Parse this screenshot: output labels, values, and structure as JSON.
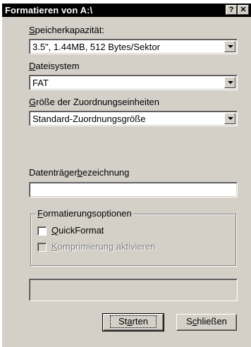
{
  "window": {
    "title": "Formatieren von A:\\",
    "help_button": "?",
    "close_button": "✕"
  },
  "capacity": {
    "label_accel": "S",
    "label_rest": "peicherkapazität:",
    "value": "3.5\", 1.44MB, 512 Bytes/Sektor"
  },
  "filesystem": {
    "label_accel": "D",
    "label_rest": "ateisystem",
    "value": "FAT"
  },
  "allocation": {
    "label_accel": "G",
    "label_rest": "röße der Zuordnungseinheiten",
    "value": "Standard-Zuordnungsgröße"
  },
  "volume_label": {
    "label_pre": "Datenträger",
    "label_accel": "b",
    "label_rest": "ezeichnung",
    "value": ""
  },
  "options": {
    "legend_accel": "F",
    "legend_rest": "ormatierungsoptionen",
    "quickformat": {
      "accel": "Q",
      "rest": "uickFormat",
      "checked": false
    },
    "compress": {
      "accel": "K",
      "rest": "omprimierung aktivieren",
      "checked": false,
      "enabled": false
    }
  },
  "status_text": "",
  "buttons": {
    "start": {
      "pre": "St",
      "accel": "a",
      "rest": "rten"
    },
    "close": {
      "pre": "S",
      "accel": "c",
      "rest": "hließen"
    }
  }
}
